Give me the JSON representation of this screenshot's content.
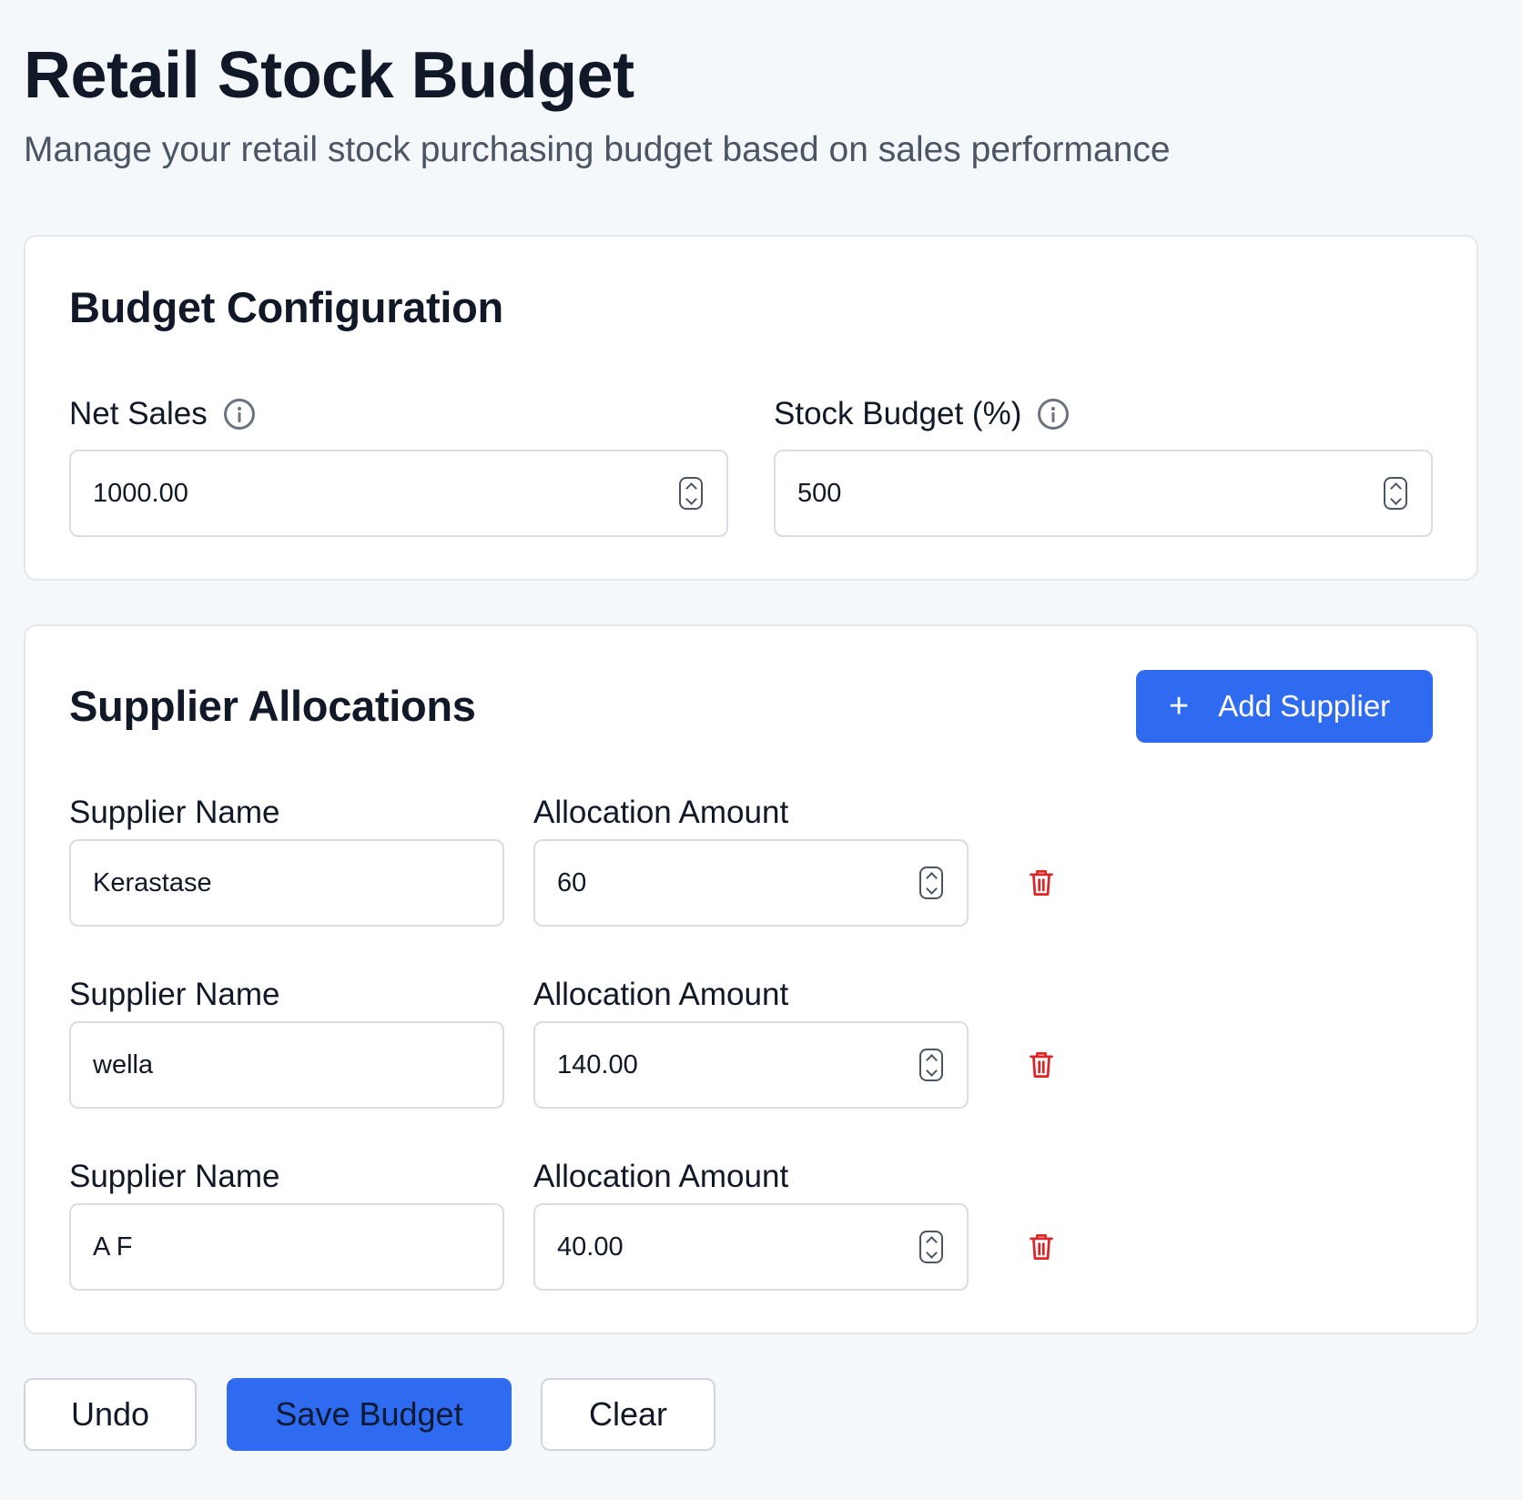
{
  "header": {
    "title": "Retail Stock Budget",
    "subtitle": "Manage your retail stock purchasing budget based on sales performance"
  },
  "config": {
    "title": "Budget Configuration",
    "net_sales": {
      "label": "Net Sales",
      "value": "1000.00"
    },
    "stock_budget": {
      "label": "Stock Budget (%)",
      "value": "500"
    }
  },
  "allocations": {
    "title": "Supplier Allocations",
    "add_label": "Add Supplier",
    "name_label": "Supplier Name",
    "amount_label": "Allocation Amount",
    "rows": [
      {
        "name": "Kerastase",
        "amount": "60"
      },
      {
        "name": "wella",
        "amount": "140.00"
      },
      {
        "name": "A F",
        "amount": "40.00"
      }
    ]
  },
  "actions": {
    "undo": "Undo",
    "save": "Save Budget",
    "clear": "Clear"
  },
  "icons": {
    "info": "info-icon",
    "spinner": "number-spinner-icon",
    "delete": "trash-icon",
    "add": "plus-icon"
  },
  "colors": {
    "primary": "#2f6bf0",
    "danger": "#dc2626",
    "background": "#f5f8fb"
  }
}
